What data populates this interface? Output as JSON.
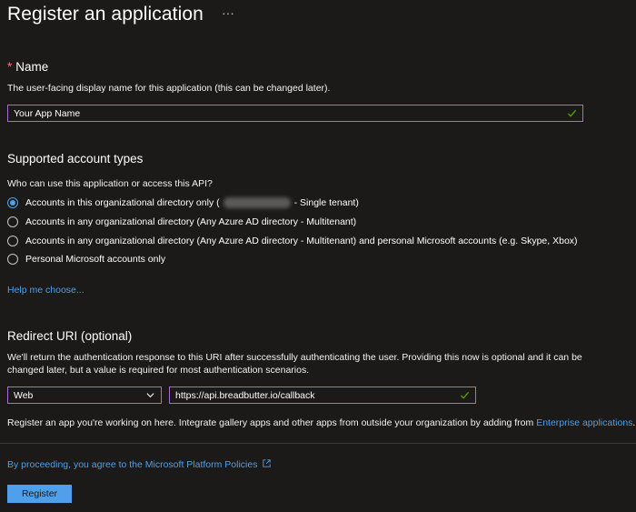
{
  "header": {
    "title": "Register an application",
    "more_label": "···"
  },
  "name_section": {
    "required_marker": "*",
    "title": "Name",
    "description": "The user-facing display name for this application (this can be changed later).",
    "input_value": "Your App Name"
  },
  "account_types": {
    "title": "Supported account types",
    "question": "Who can use this application or access this API?",
    "options": [
      {
        "label_before": "Accounts in this organizational directory only (",
        "label_after": " - Single tenant)",
        "checked": true
      },
      {
        "label": "Accounts in any organizational directory (Any Azure AD directory - Multitenant)",
        "checked": false
      },
      {
        "label": "Accounts in any organizational directory (Any Azure AD directory - Multitenant) and personal Microsoft accounts (e.g. Skype, Xbox)",
        "checked": false
      },
      {
        "label": "Personal Microsoft accounts only",
        "checked": false
      }
    ],
    "help_link": "Help me choose..."
  },
  "redirect": {
    "title": "Redirect URI (optional)",
    "description_line1": "We'll return the authentication response to this URI after successfully authenticating the user. Providing this now is optional and it can be",
    "description_line2": "changed later, but a value is required for most authentication scenarios.",
    "platform_value": "Web",
    "uri_value": "https://api.breadbutter.io/callback"
  },
  "gallery_note": {
    "text": "Register an app you're working on here. Integrate gallery apps and other apps from outside your organization by adding from ",
    "link": "Enterprise applications",
    "end": "."
  },
  "footer": {
    "policy_link": "By proceeding, you agree to the Microsoft Platform Policies",
    "register_label": "Register"
  },
  "colors": {
    "background": "#1b1a19",
    "accent": "#4f9fea",
    "input_border": "#a96bd6",
    "success": "#57a300",
    "required": "#f1707b"
  }
}
